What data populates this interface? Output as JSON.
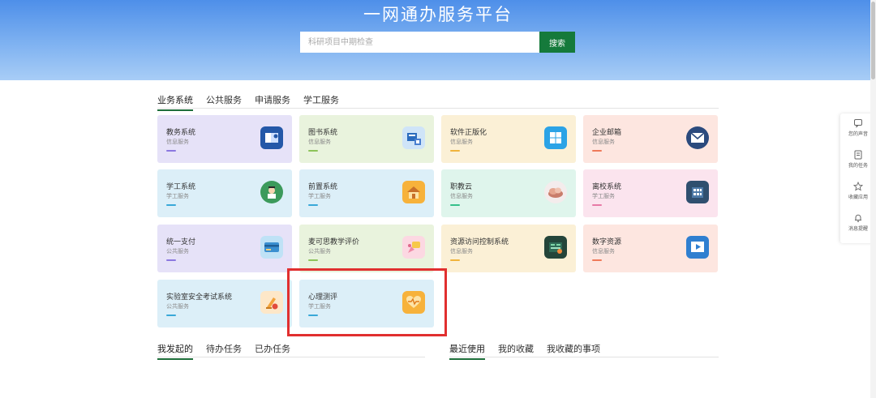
{
  "header": {
    "title": "一网通办服务平台",
    "search": {
      "placeholder": "科研项目中期检查",
      "value": ""
    },
    "search_button": "搜索"
  },
  "tabs": [
    {
      "label": "业务系统",
      "active": true
    },
    {
      "label": "公共服务",
      "active": false
    },
    {
      "label": "申请服务",
      "active": false
    },
    {
      "label": "学工服务",
      "active": false
    }
  ],
  "cards": [
    {
      "name": "教务系统",
      "category": "信息服务",
      "bg": "#e6e2f8",
      "accent": "#8b78e0",
      "icon": "book-icon"
    },
    {
      "name": "图书系统",
      "category": "信息服务",
      "bg": "#e9f3dd",
      "accent": "#8dc35a",
      "icon": "library-icon"
    },
    {
      "name": "软件正版化",
      "category": "信息服务",
      "bg": "#fbf0d6",
      "accent": "#f0b43c",
      "icon": "windows-icon"
    },
    {
      "name": "企业邮箱",
      "category": "信息服务",
      "bg": "#fde6e0",
      "accent": "#ef7a5a",
      "icon": "mail-icon"
    },
    {
      "name": "学工系统",
      "category": "学工服务",
      "bg": "#dceff8",
      "accent": "#39a8d8",
      "icon": "student-icon"
    },
    {
      "name": "前置系统",
      "category": "学工服务",
      "bg": "#dceff8",
      "accent": "#39a8d8",
      "icon": "home-icon"
    },
    {
      "name": "职教云",
      "category": "信息服务",
      "bg": "#dff5ec",
      "accent": "#35c08a",
      "icon": "cloud-icon"
    },
    {
      "name": "离校系统",
      "category": "学工服务",
      "bg": "#fbe4ee",
      "accent": "#e77aa6",
      "icon": "building-icon"
    },
    {
      "name": "统一支付",
      "category": "公共服务",
      "bg": "#e6e2f8",
      "accent": "#8b78e0",
      "icon": "card-icon"
    },
    {
      "name": "麦可思教学评价",
      "category": "公共服务",
      "bg": "#e9f3dd",
      "accent": "#8dc35a",
      "icon": "evaluation-icon"
    },
    {
      "name": "资源访问控制系统",
      "category": "信息服务",
      "bg": "#fbf0d6",
      "accent": "#f0b43c",
      "icon": "dashboard-icon"
    },
    {
      "name": "数字资源",
      "category": "信息服务",
      "bg": "#fde6e0",
      "accent": "#ef7a5a",
      "icon": "video-icon"
    },
    {
      "name": "实验室安全考试系统",
      "category": "公共服务",
      "bg": "#dceff8",
      "accent": "#39a8d8",
      "icon": "lab-icon"
    },
    {
      "name": "心理测评",
      "category": "学工服务",
      "bg": "#dceff8",
      "accent": "#39a8d8",
      "icon": "heart-icon"
    }
  ],
  "bottom_left_tabs": [
    {
      "label": "我发起的",
      "active": true
    },
    {
      "label": "待办任务",
      "active": false
    },
    {
      "label": "已办任务",
      "active": false
    }
  ],
  "bottom_right_tabs": [
    {
      "label": "最近使用",
      "active": true
    },
    {
      "label": "我的收藏",
      "active": false
    },
    {
      "label": "我收藏的事项",
      "active": false
    }
  ],
  "side_panel": [
    {
      "label": "您的声音",
      "icon": "chat-icon"
    },
    {
      "label": "我的任务",
      "icon": "task-icon"
    },
    {
      "label": "收藏应用",
      "icon": "star-icon"
    },
    {
      "label": "消息提醒",
      "icon": "bell-icon"
    }
  ],
  "colors": {
    "header_blue": "#4e8fe9",
    "search_button": "#157a3b",
    "tab_underline": "#1e6f3b",
    "highlight_red": "#e12f2f"
  }
}
